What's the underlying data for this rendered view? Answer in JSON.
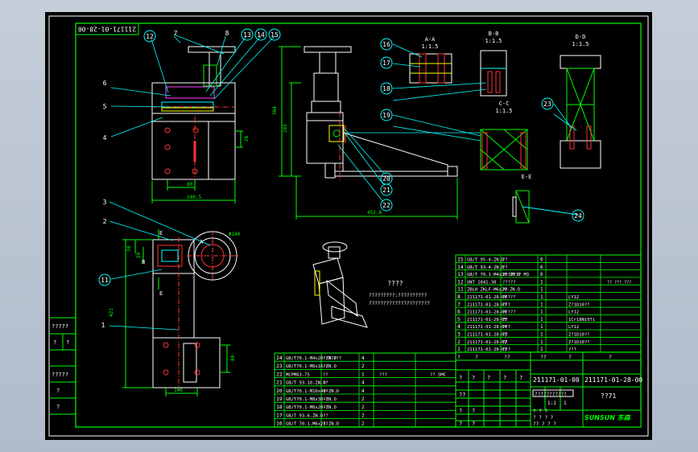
{
  "drawing_number": "211171-01-28-00",
  "drawing_number_short": "211171-01-00",
  "sheet_label": "??71",
  "company_logo_text": "SUNSUN 东森",
  "views": {
    "aa": {
      "title": "A-A",
      "scale": "1:1.5"
    },
    "bb": {
      "title": "B-B",
      "scale": "1:1.5"
    },
    "cc": {
      "title": "C-C",
      "scale": "1:1.5"
    },
    "dd": {
      "title": "D-D",
      "scale": "1:1.5"
    },
    "ee": {
      "title": "E-E"
    }
  },
  "section_marks": {
    "a": "A",
    "b": "B",
    "e": "E"
  },
  "balloons": [
    "1",
    "2",
    "3",
    "4",
    "5",
    "6",
    "7",
    "8",
    "11",
    "12",
    "13",
    "14",
    "15",
    "16",
    "17",
    "18",
    "19",
    "20",
    "21",
    "22",
    "23",
    "24"
  ],
  "dimensions": {
    "d240": "240.5",
    "d80a": "80",
    "d26": "26",
    "d364": "364",
    "d285": "285",
    "d452": "452.8",
    "d140": "Φ140",
    "d30": "30",
    "d50": "50",
    "d421": "421",
    "d100": "100",
    "d80b": "80"
  },
  "notes": {
    "iso_title": "????",
    "iso_note_1": "?????????:??????????",
    "iso_note_2": "?????????????????????"
  },
  "left_strip": [
    "?????",
    "?",
    "?",
    "?????",
    "?",
    "?"
  ],
  "bom_upper": [
    {
      "no": "15",
      "code": "GB/T 95-4-ZN.D",
      "name": "??",
      "qty": "6",
      "mat": ""
    },
    {
      "no": "14",
      "code": "GB/T 93-4-ZN.D",
      "name": "??",
      "qty": "6",
      "mat": ""
    },
    {
      "no": "13",
      "code": "GB/T 70.1-M4x20-ZN.D",
      "name": "??????? M3",
      "qty": "6",
      "mat": ""
    },
    {
      "no": "12",
      "code": "UNT 1041-30",
      "name": "?????",
      "qty": "1",
      "mat": "",
      "extra": "?? ???_???"
    },
    {
      "no": "11",
      "code": "ZBLH ZKLF-M6x20-ZN.D",
      "name": "??",
      "qty": "1",
      "mat": ""
    },
    {
      "no": "8",
      "code": "211171-01-28-08",
      "name": "?????",
      "qty": "1",
      "mat": "LY12"
    },
    {
      "no": "7",
      "code": "211171-01-28-07",
      "name": "???",
      "qty": "1",
      "mat": "Z?1D10??"
    },
    {
      "no": "6",
      "code": "211171-01-28-06",
      "name": "?????",
      "qty": "1",
      "mat": "LY12"
    },
    {
      "no": "5",
      "code": "211171-01-28-05",
      "name": "??",
      "qty": "1",
      "mat": "1Cr18Ni9Ti"
    },
    {
      "no": "4",
      "code": "211171-01-28-04",
      "name": "???",
      "qty": "1",
      "mat": "LY12"
    },
    {
      "no": "3",
      "code": "211171-01-28-03",
      "name": "??",
      "qty": "1",
      "mat": "Z?1D10??"
    },
    {
      "no": "2",
      "code": "211171-01-28-02",
      "name": "??",
      "qty": "1",
      "mat": "Z?1D10??"
    },
    {
      "no": "1",
      "code": "211171-01-28-01",
      "name": "???",
      "qty": "1",
      "mat": "???"
    }
  ],
  "bom_lower": [
    {
      "no": "24",
      "code": "GB/T70.1-M4x20-ZN.D",
      "name": "???????",
      "qty": "4",
      "extra": ""
    },
    {
      "no": "23",
      "code": "GB/T70.1-M6x16-ZN.D",
      "name": "??",
      "qty": "2",
      "extra": ""
    },
    {
      "no": "22",
      "code": "MCPM63-75",
      "name": "??",
      "qty": "1",
      "extra": "???",
      "extra2": "?? SMC"
    },
    {
      "no": "21",
      "code": "GB/T 93-10-ZN.D",
      "name": "??",
      "qty": "4",
      "extra": ""
    },
    {
      "no": "20",
      "code": "GB/T70.1-M10x40-ZN.D",
      "name": "??",
      "qty": "4",
      "extra": ""
    },
    {
      "no": "19",
      "code": "GB/T70.1-M8x30-ZN.D",
      "name": "??",
      "qty": "2",
      "extra": ""
    },
    {
      "no": "18",
      "code": "GB/T70.1-M6x20-ZN.D",
      "name": "??",
      "qty": "2",
      "extra": ""
    },
    {
      "no": "17",
      "code": "GB/T 93-6-ZN.D",
      "name": "??",
      "qty": "2",
      "extra": ""
    },
    {
      "no": "16",
      "code": "GB/T 70.1-M6x25-ZN.D",
      "name": "??",
      "qty": "2",
      "extra": ""
    }
  ],
  "bom_header": [
    "?",
    "?",
    "??",
    "??",
    "?",
    "?"
  ],
  "title_block": {
    "cells_q": "?",
    "cells_small": [
      "?",
      "?",
      "?",
      "?",
      "?",
      "??",
      "?",
      "?",
      "?",
      "?"
    ],
    "qmarks_a": "???????????",
    "qmarks_b": "? ? ?",
    "qmarks_c": "? ? ? ?",
    "qmarks_d": "?? ? ? ?",
    "r1": "1:1",
    "r2": "1"
  }
}
